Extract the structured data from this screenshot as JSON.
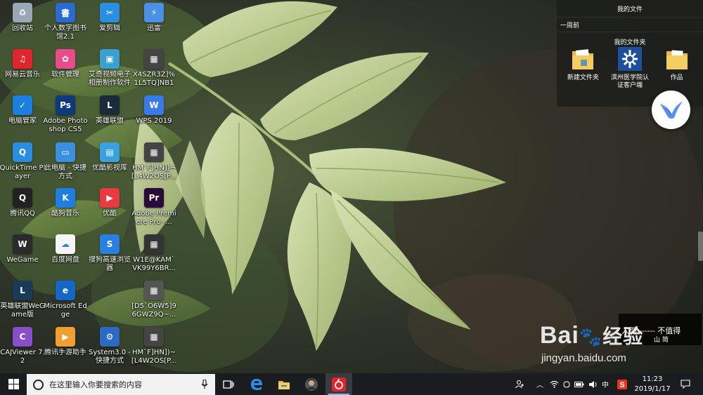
{
  "files_panel": {
    "title": "我的文件",
    "recent_label": "一周前",
    "section_title": "我的文件夹",
    "folders": [
      {
        "label": "新建文件夹",
        "icon": "folder-icon"
      },
      {
        "label": "滨州医学院认证客户端",
        "icon": "campus-client-icon"
      },
      {
        "label": "作品",
        "icon": "folder-icon"
      }
    ]
  },
  "desktop_icons": [
    {
      "label": "回收站",
      "icon": "recycle-bin-icon",
      "color": "#9aa7b4",
      "glyph": "♻"
    },
    {
      "label": "网易云音乐",
      "icon": "netease-music-icon",
      "color": "#e0262c",
      "glyph": "♫"
    },
    {
      "label": "电脑管家",
      "icon": "pc-manager-icon",
      "color": "#1b7fe0",
      "glyph": "✓"
    },
    {
      "label": "QuickTime Player",
      "icon": "quicktime-icon",
      "color": "#2a8de0",
      "glyph": "Q"
    },
    {
      "label": "腾讯QQ",
      "icon": "qq-icon",
      "color": "#222222",
      "glyph": "Q"
    },
    {
      "label": "WeGame",
      "icon": "wegame-icon",
      "color": "#2b2b2b",
      "glyph": "W"
    },
    {
      "label": "英雄联盟WeGame版",
      "icon": "lol-wegame-icon",
      "color": "#1a3a5a",
      "glyph": "L"
    },
    {
      "label": "CAJViewer 7.2",
      "icon": "cajviewer-icon",
      "color": "#8a4fc8",
      "glyph": "C"
    },
    {
      "label": "个人数字图书馆2.1",
      "icon": "digital-library-icon",
      "color": "#2a6bd0",
      "glyph": "書"
    },
    {
      "label": "软件管理",
      "icon": "software-manager-icon",
      "color": "#e94c8a",
      "glyph": "✿"
    },
    {
      "label": "Adobe Photoshop CS5",
      "icon": "photoshop-icon",
      "color": "#0e3a7a",
      "glyph": "Ps"
    },
    {
      "label": "此电脑 - 快捷方式",
      "icon": "this-pc-icon",
      "color": "#3b8ee0",
      "glyph": "▭"
    },
    {
      "label": "酷狗音乐",
      "icon": "kugou-icon",
      "color": "#1f7fe0",
      "glyph": "K"
    },
    {
      "label": "百度网盘",
      "icon": "baidu-netdisk-icon",
      "color": "#f5f5f5",
      "glyph": "☁"
    },
    {
      "label": "Microsoft Edge",
      "icon": "edge-icon",
      "color": "#1567c6",
      "glyph": "e"
    },
    {
      "label": "腾讯手游助手",
      "icon": "tencent-mobile-assistant-icon",
      "color": "#f0a030",
      "glyph": "▶"
    },
    {
      "label": "爱剪辑",
      "icon": "aijianji-icon",
      "color": "#2a8fe0",
      "glyph": "✂"
    },
    {
      "label": "艾奇视频电子相册制作软件",
      "icon": "aiqi-video-album-icon",
      "color": "#3aa0d0",
      "glyph": "▣"
    },
    {
      "label": "英雄联盟",
      "icon": "lol-icon",
      "color": "#1b2b3b",
      "glyph": "L"
    },
    {
      "label": "优酷影视库",
      "icon": "youku-library-icon",
      "color": "#3aa0e0",
      "glyph": "▤"
    },
    {
      "label": "优酷",
      "icon": "youku-icon",
      "color": "#e83a40",
      "glyph": "▶"
    },
    {
      "label": "搜狗高速浏览器",
      "icon": "sogou-browser-icon",
      "color": "#2a7fe0",
      "glyph": "S"
    },
    {
      "label": "",
      "icon": "blank-icon",
      "color": "transparent",
      "glyph": ""
    },
    {
      "label": "System3.0 - 快捷方式",
      "icon": "system3-icon",
      "color": "#2a6ac0",
      "glyph": "⚙"
    },
    {
      "label": "迅雷",
      "icon": "xunlei-icon",
      "color": "#4a90e8",
      "glyph": "⚡"
    },
    {
      "label": "X4SZR3Z]%1L5TQ]NB1U...",
      "icon": "image-file-icon",
      "color": "#444444",
      "glyph": "▦"
    },
    {
      "label": "WPS 2019",
      "icon": "wps-icon",
      "color": "#3a7ae8",
      "glyph": "W"
    },
    {
      "label": "HM`F]HN])~[L4W2OS[P...",
      "icon": "image-file-icon",
      "color": "#444444",
      "glyph": "▦"
    },
    {
      "label": "Adobe Premiere Pro -...",
      "icon": "premiere-icon",
      "color": "#2a0a3a",
      "glyph": "Pr"
    },
    {
      "label": "W1E@KAM`VK99Y6BR...",
      "icon": "image-file-icon",
      "color": "#333333",
      "glyph": "▦"
    },
    {
      "label": "[D5`O6W5]96GWZ9Q~...",
      "icon": "image-file-icon",
      "color": "#555555",
      "glyph": "▦"
    },
    {
      "label": "HM`F]HN])~[L4W2OS[P...",
      "icon": "image-file-icon",
      "color": "#444444",
      "glyph": "▦"
    }
  ],
  "taskbar": {
    "search_placeholder": "在这里输入你要搜索的内容",
    "time": "11:23",
    "date": "2019/1/17",
    "ime": "中"
  },
  "overlay": {
    "poem_line1": "人間 ------ 不值得",
    "poem_line2": "山 简",
    "watermark_brand": "Bai",
    "watermark_brand2": "经验",
    "watermark_url": "jingyan.baidu.com"
  },
  "colors": {
    "taskbar_bg": "#1b1c1f",
    "accent": "#7eb4ea",
    "leaf_light": "#c8d6a2",
    "leaf_mid": "#9fb878"
  }
}
